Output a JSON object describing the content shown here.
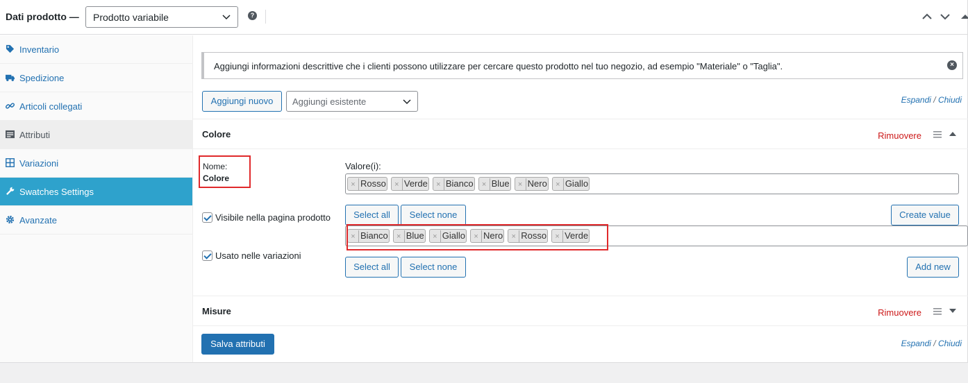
{
  "header": {
    "title": "Dati prodotto —",
    "product_type": "Prodotto variabile",
    "help": "?"
  },
  "sidebar": {
    "items": [
      {
        "label": "Inventario",
        "icon": "tag-icon"
      },
      {
        "label": "Spedizione",
        "icon": "truck-icon"
      },
      {
        "label": "Articoli collegati",
        "icon": "link-icon"
      },
      {
        "label": "Attributi",
        "icon": "list-icon"
      },
      {
        "label": "Variazioni",
        "icon": "grid-icon"
      },
      {
        "label": "Swatches Settings",
        "icon": "wrench-icon"
      },
      {
        "label": "Avanzate",
        "icon": "gear-icon"
      }
    ]
  },
  "notice": {
    "text": "Aggiungi informazioni descrittive che i clienti possono utilizzare per cercare questo prodotto nel tuo negozio, ad esempio \"Materiale\" o \"Taglia\"."
  },
  "toolbar": {
    "add_new": "Aggiungi nuovo",
    "add_existing_placeholder": "Aggiungi esistente",
    "expand": "Espandi",
    "separator": "/",
    "close": "Chiudi"
  },
  "attributes": [
    {
      "name": "Colore",
      "remove": "Rimuovere",
      "name_label": "Nome:",
      "values_label": "Valore(i):",
      "visible_label": "Visibile nella pagina prodotto",
      "variations_label": "Usato nelle variazioni",
      "values_top": [
        "Rosso",
        "Verde",
        "Bianco",
        "Blue",
        "Nero",
        "Giallo"
      ],
      "values_bottom": [
        "Bianco",
        "Blue",
        "Giallo",
        "Nero",
        "Rosso",
        "Verde"
      ],
      "select_all": "Select all",
      "select_none": "Select none",
      "create_value": "Create value",
      "add_new": "Add new"
    },
    {
      "name": "Misure",
      "remove": "Rimuovere"
    }
  ],
  "footer": {
    "save": "Salva attributi"
  },
  "colors": {
    "accent": "#2271b1",
    "sidebar_current": "#2ea2cc",
    "remove": "#cc1818",
    "highlight": "#e0292b"
  }
}
